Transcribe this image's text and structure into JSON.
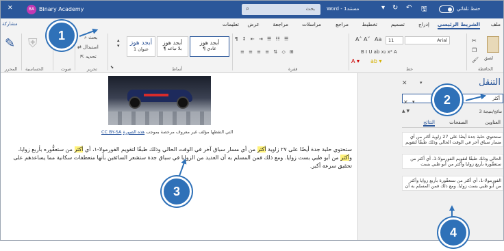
{
  "title_bar": {
    "account_initials": "BA",
    "account_name": "Binary Academy",
    "search_placeholder": "بحث",
    "doc_title": "Word - مستند1",
    "autosave_label": "حفظ تلقائي",
    "min": "—",
    "restore": "❐",
    "close": "✕"
  },
  "tabs": [
    {
      "label": "ملف"
    },
    {
      "label": "الشريط الرئيسي",
      "active": true
    },
    {
      "label": "إدراج"
    },
    {
      "label": "تصميم"
    },
    {
      "label": "تخطيط"
    },
    {
      "label": "مراجع"
    },
    {
      "label": "مراسلات"
    },
    {
      "label": "مراجعة"
    },
    {
      "label": "عرض"
    },
    {
      "label": "تعليمات"
    }
  ],
  "ribbon": {
    "groups": {
      "clipboard": "الحافظة",
      "font": "خط",
      "paragraph": "فقرة",
      "styles": "أنماط",
      "editing": "تحرير",
      "voice": "صوت",
      "sensitivity": "الحساسية",
      "editor": "المحرر"
    },
    "font_name": "Arial",
    "font_size": "11",
    "styles": [
      {
        "sample": "أبجد هوز",
        "name": "¶ عادي"
      },
      {
        "sample": "أبجد هوز",
        "name": "¶ بلا تباعد"
      },
      {
        "sample": "أبجد هوز",
        "name": "عنوان 1"
      },
      {
        "sample": "أبجد هوز",
        "name": ""
      }
    ],
    "editing": {
      "find": "بحث",
      "replace": "استبدال",
      "select": "تحديد"
    },
    "paste": "لصق",
    "share": "مشاركة"
  },
  "document": {
    "caption_link": "هذه الصورة",
    "caption_text": " التي التقطها مؤلف غير معروف مرخصة بموجب ",
    "caption_license": "CC BY-SA",
    "paragraph": [
      {
        "t": "ستحتوي حلبة جدة أيضًا على ٢٧ زاوية "
      },
      {
        "t": "أكثر",
        "hl": true
      },
      {
        "t": " من أي مسار سباق آخر في الوقت الحالي وذلك طبقًا لتقويم الفورمولا-١، أي "
      },
      {
        "t": "أكثر",
        "hl": true
      },
      {
        "t": " من ستعقُّوره بأربع زوايا، و"
      },
      {
        "t": "أكثر",
        "hl": true
      },
      {
        "t": " من أبو ظبي بست زوايا. ومع ذلك فمن المسلم به أن العديد من الزوايا في سباق جدة ستشعر السائقين بأنها منعطفات سكانية مما يساعدهم على تحقيق سرعة أكبر."
      }
    ]
  },
  "nav_pane": {
    "title": "التنقل",
    "search_value": "أكثر",
    "result_count": "3 نتائج/نتيجة",
    "tabs": [
      "العناوين",
      "الصفحات",
      "النتائج"
    ],
    "results": [
      "ستحتوي حلبة جدة أيضًا على 27 زاوية أكثر من أي مسار سباق آخر في الوقت الحالي وذلك طبقًا لتقويم",
      "الحالي وذلك طبقًا لتقويم الفورمولا-1، أي أكثر من ستعقّورة بأربع زوايا وأكثر من أبو ظبي بست",
      "الفورمولا-1، أي أكثر من ستعقّورة بأربع زوايا وأكثر من أبو ظبي بست زوايا. ومع ذلك فمن المسلم به أن"
    ]
  },
  "callouts": [
    "1",
    "2",
    "3",
    "4"
  ],
  "colors": {
    "accent": "#2b579a",
    "callout": "#2f71b8",
    "highlight": "#fff27a"
  }
}
